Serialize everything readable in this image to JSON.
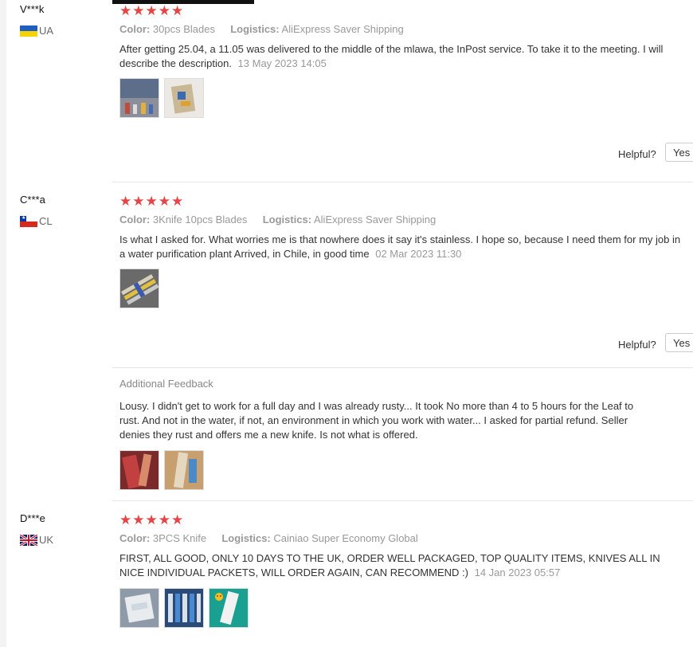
{
  "reviews": [
    {
      "user": "V***k",
      "country": "UA",
      "stars": "★★★★★",
      "color_label": "Color:",
      "color_value": "30pcs Blades",
      "logistics_label": "Logistics:",
      "logistics_value": "AliExpress Saver Shipping",
      "text": "After getting 25.04, a 11.05 was delivered to the middle of the mlawa, the InPost service. To take it to the meeting. I will describe the description.",
      "date": "13 May 2023 14:05",
      "helpful_label": "Helpful?",
      "yes_label": "Yes"
    },
    {
      "user": "C***a",
      "country": "CL",
      "stars": "★★★★★",
      "color_label": "Color:",
      "color_value": "3Knife 10pcs Blades",
      "logistics_label": "Logistics:",
      "logistics_value": "AliExpress Saver Shipping",
      "text": "Is what I asked for. What worries me is that nowhere does it say it's stainless. I hope so, because I need them for my job in a water purification plant Arrived, in Chile, in good time",
      "date": "02 Mar 2023 11:30",
      "helpful_label": "Helpful?",
      "yes_label": "Yes",
      "additional_title": "Additional Feedback",
      "additional_text": "Lousy. I didn't get to work for a full day and I was already rusty... It took No more than 4 to 5 hours for the Leaf to rust. And not in the water, if not, an environment in which you work with water... I asked for partial refund. Seller denies they rust and offers me a new knife. Is not what is offered."
    },
    {
      "user": "D***e",
      "country": "UK",
      "stars": "★★★★★",
      "color_label": "Color:",
      "color_value": "3PCS Knife",
      "logistics_label": "Logistics:",
      "logistics_value": "Cainiao Super Economy Global",
      "text": "FIRST, ALL GOOD, ONLY 10 DAYS TO THE UK, ORDER WELL PACKAGED, TOP QUALITY ITEMS, KNIVES ALL IN NICE INDIVIDUAL PACKETS, WILL ORDER AGAIN, CAN RECOMMEND :)",
      "date": "14 Jan 2023 05:57"
    }
  ],
  "colors": {
    "star": "#e64545",
    "meta": "#999999"
  }
}
